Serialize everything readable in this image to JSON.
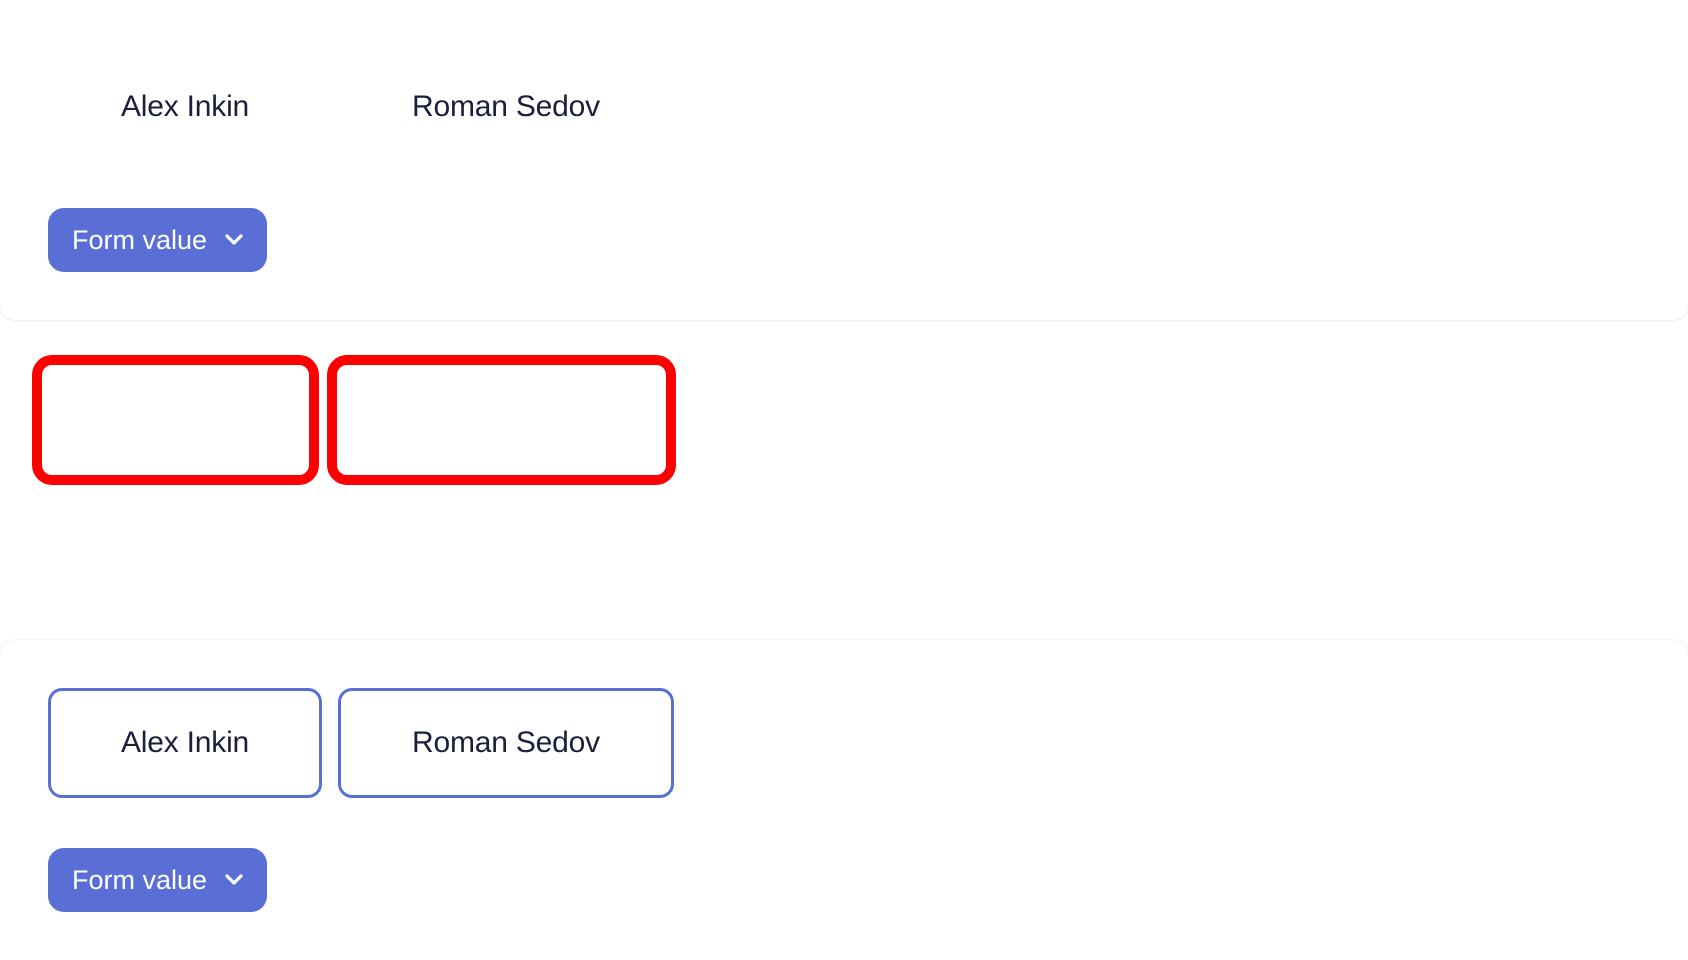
{
  "top_section": {
    "chips": [
      {
        "label": "Alex Inkin"
      },
      {
        "label": "Roman Sedov"
      }
    ],
    "select": {
      "label": "Form value"
    }
  },
  "bottom_section": {
    "chips": [
      {
        "label": "Alex Inkin"
      },
      {
        "label": "Roman Sedov"
      }
    ],
    "select": {
      "label": "Form value"
    }
  },
  "colors": {
    "accent": "#5a6fd6",
    "highlight": "#ff0000",
    "text": "#1b1f3b"
  },
  "icons": {
    "select_chevron": "chevron-down-icon"
  }
}
